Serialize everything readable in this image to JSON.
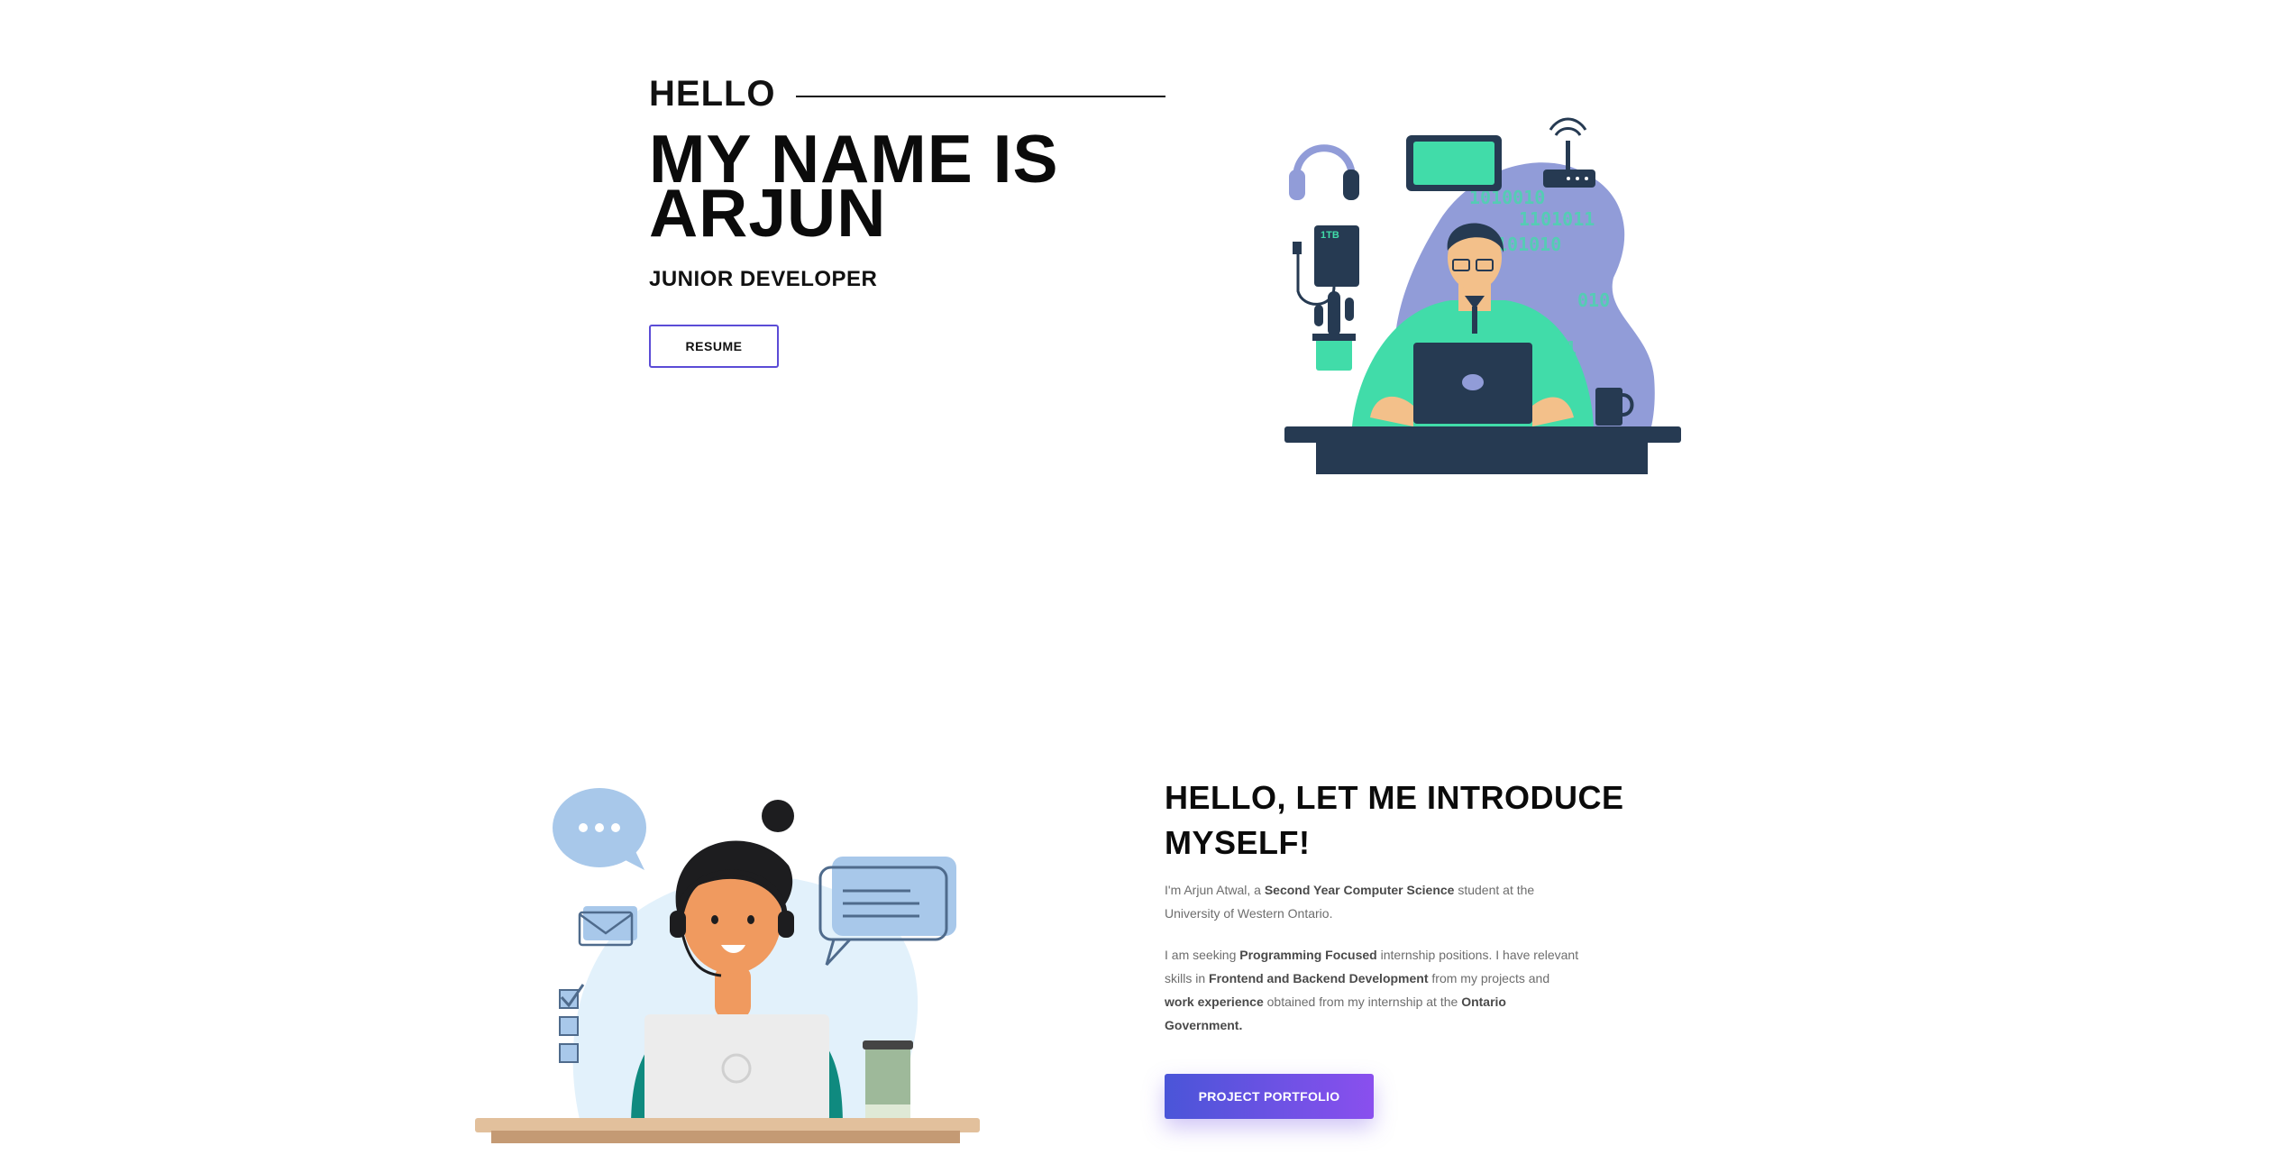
{
  "hero": {
    "greeting": "HELLO",
    "title": "MY NAME IS ARJUN",
    "role": "JUNIOR DEVELOPER",
    "resume_label": "RESUME",
    "hdd_label": "1TB"
  },
  "about": {
    "title": "HELLO, LET ME INTRODUCE MYSELF!",
    "p1": [
      {
        "text": "I'm Arjun Atwal, a ",
        "bold": false
      },
      {
        "text": "Second Year Computer Science",
        "bold": true
      },
      {
        "text": " student at the University of Western Ontario.",
        "bold": false
      }
    ],
    "p2": [
      {
        "text": "I am seeking ",
        "bold": false
      },
      {
        "text": "Programming Focused",
        "bold": true
      },
      {
        "text": " internship positions. I have relevant skills in ",
        "bold": false
      },
      {
        "text": "Frontend and Backend Development",
        "bold": true
      },
      {
        "text": " from my projects and ",
        "bold": false
      },
      {
        "text": "work experience",
        "bold": true
      },
      {
        "text": " obtained from my internship at the ",
        "bold": false
      },
      {
        "text": "Ontario Government.",
        "bold": true
      }
    ],
    "portfolio_label": "PROJECT PORTFOLIO"
  },
  "colors": {
    "accent_gradient_start": "#4a55d8",
    "accent_gradient_end": "#8a4fee",
    "resume_border": "#5b4cd6",
    "illustration_blob": "#919cd8",
    "illustration_green": "#41dca9",
    "illustration_navy": "#263a52"
  },
  "icons": [
    "headphones-icon",
    "tablet-icon",
    "router-icon",
    "hard-drive-icon",
    "cactus-icon",
    "mug-icon",
    "laptop-icon",
    "chat-bubble-icon",
    "envelope-icon",
    "checkbox-icon",
    "coffee-cup-icon"
  ]
}
